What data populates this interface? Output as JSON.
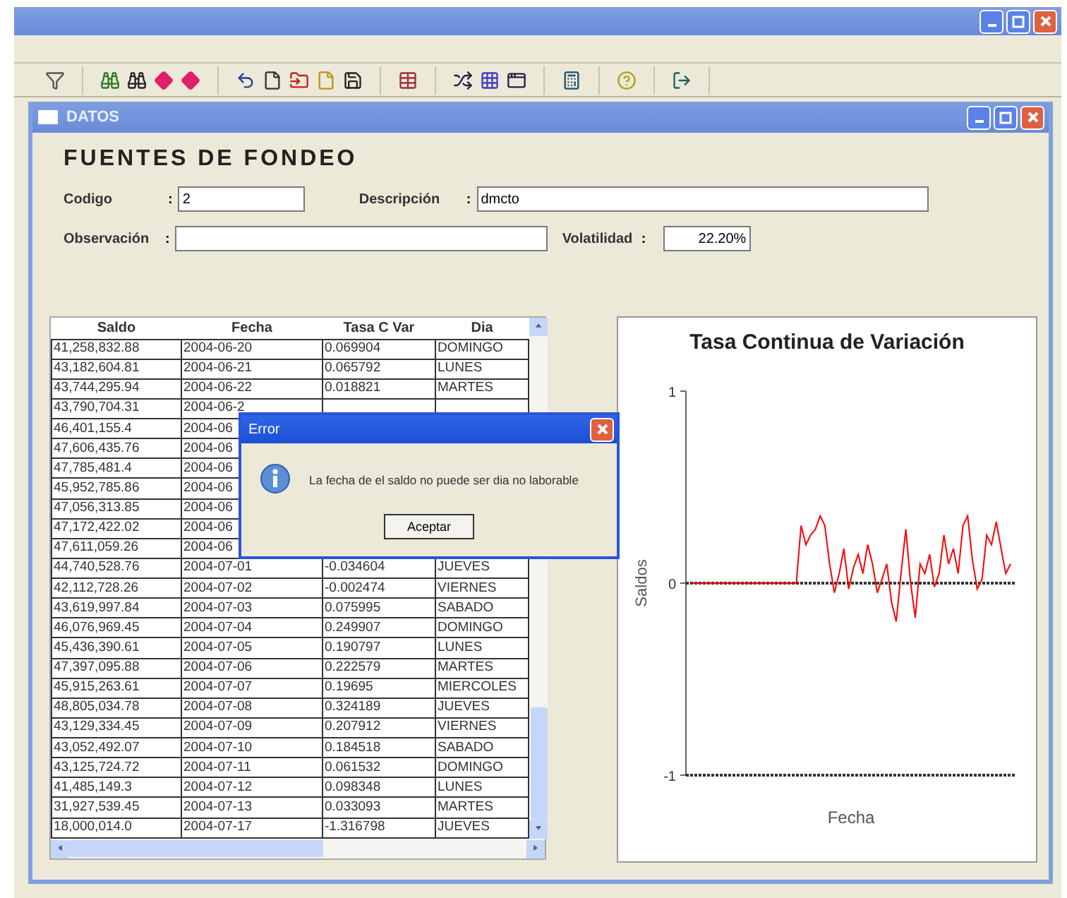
{
  "datos_window": {
    "title": "DATOS"
  },
  "form": {
    "heading": "FUENTES DE FONDEO",
    "fields": [
      {
        "label": "Codigo",
        "separator": ":",
        "value": "2"
      },
      {
        "label": "Descripción",
        "separator": ":",
        "value": "dmcto"
      },
      {
        "label": "Observación",
        "separator": ":"
      },
      {
        "label": "Volatilidad",
        "separator": ":",
        "value": "22.20%"
      }
    ]
  },
  "table": {
    "columns": [
      "Saldo",
      "Fecha",
      "Tasa C Var",
      "Dia"
    ],
    "rows": [
      [
        "41,258,832.88",
        "2004-06-20",
        "0.069904",
        "DOMINGO"
      ],
      [
        "43,182,604.81",
        "2004-06-21",
        "0.065792",
        "LUNES"
      ],
      [
        "43,744,295.94",
        "2004-06-22",
        "0.018821",
        "MARTES"
      ],
      [
        "43,790,704.31",
        "2004-06-2",
        "",
        ""
      ],
      [
        "46,401,155.4",
        "2004-06",
        "",
        ""
      ],
      [
        "47,606,435.76",
        "2004-06",
        "",
        ""
      ],
      [
        "47,785,481.4",
        "2004-06",
        "",
        ""
      ],
      [
        "45,952,785.86",
        "2004-06",
        "",
        ""
      ],
      [
        "47,056,313.85",
        "2004-06",
        "",
        ""
      ],
      [
        "47,172,422.02",
        "2004-06",
        "",
        ""
      ],
      [
        "47,611,059.26",
        "2004-06",
        "",
        ""
      ],
      [
        "44,740,528.76",
        "2004-07-01",
        "-0.034604",
        "JUEVES"
      ],
      [
        "42,112,728.26",
        "2004-07-02",
        "-0.002474",
        "VIERNES"
      ],
      [
        "43,619,997.84",
        "2004-07-03",
        "0.075995",
        "SABADO"
      ],
      [
        "46,076,969.45",
        "2004-07-04",
        "0.249907",
        "DOMINGO"
      ],
      [
        "45,436,390.61",
        "2004-07-05",
        "0.190797",
        "LUNES"
      ],
      [
        "47,397,095.88",
        "2004-07-06",
        "0.222579",
        "MARTES"
      ],
      [
        "45,915,263.61",
        "2004-07-07",
        "0.19695",
        "MIERCOLES"
      ],
      [
        "48,805,034.78",
        "2004-07-08",
        "0.324189",
        "JUEVES"
      ],
      [
        "43,129,334.45",
        "2004-07-09",
        "0.207912",
        "VIERNES"
      ],
      [
        "43,052,492.07",
        "2004-07-10",
        "0.184518",
        "SABADO"
      ],
      [
        "43,125,724.72",
        "2004-07-11",
        "0.061532",
        "DOMINGO"
      ],
      [
        "41,485,149.3",
        "2004-07-12",
        "0.098348",
        "LUNES"
      ],
      [
        "31,927,539.45",
        "2004-07-13",
        "0.033093",
        "MARTES"
      ],
      [
        "18,000,014.0",
        "2004-07-17",
        "-1.316798",
        "JUEVES"
      ]
    ]
  },
  "chart": {
    "chart_data": {
      "type": "line",
      "title": "Tasa Continua de Variación",
      "xlabel": "Fecha",
      "ylabel": "Saldos",
      "ylim": [
        -1,
        1
      ],
      "yticks": [
        -1,
        0,
        1
      ],
      "series": [
        {
          "color": "#ff0000",
          "values": [
            0,
            0,
            0,
            0,
            0,
            0,
            0,
            0,
            0,
            0,
            0,
            0,
            0,
            0,
            0,
            0,
            0,
            0,
            0,
            0,
            0,
            0,
            0,
            0.3,
            0.2,
            0.25,
            0.28,
            0.35,
            0.3,
            0.1,
            -0.05,
            0.05,
            0.18,
            -0.03,
            0.08,
            0.15,
            0.05,
            0.2,
            0.1,
            -0.05,
            0.02,
            0.1,
            -0.1,
            -0.2,
            0.05,
            0.28,
            0.0,
            -0.18,
            0.1,
            0.05,
            0.15,
            -0.02,
            0.05,
            0.25,
            0.1,
            0.18,
            0.05,
            0.3,
            0.35,
            0.12,
            -0.03,
            0.02,
            0.25,
            0.2,
            0.32,
            0.18,
            0.05,
            0.1
          ]
        }
      ]
    }
  },
  "dialog": {
    "title": "Error",
    "message": "La fecha de el saldo no puede ser dia no laborable",
    "button": "Aceptar"
  }
}
